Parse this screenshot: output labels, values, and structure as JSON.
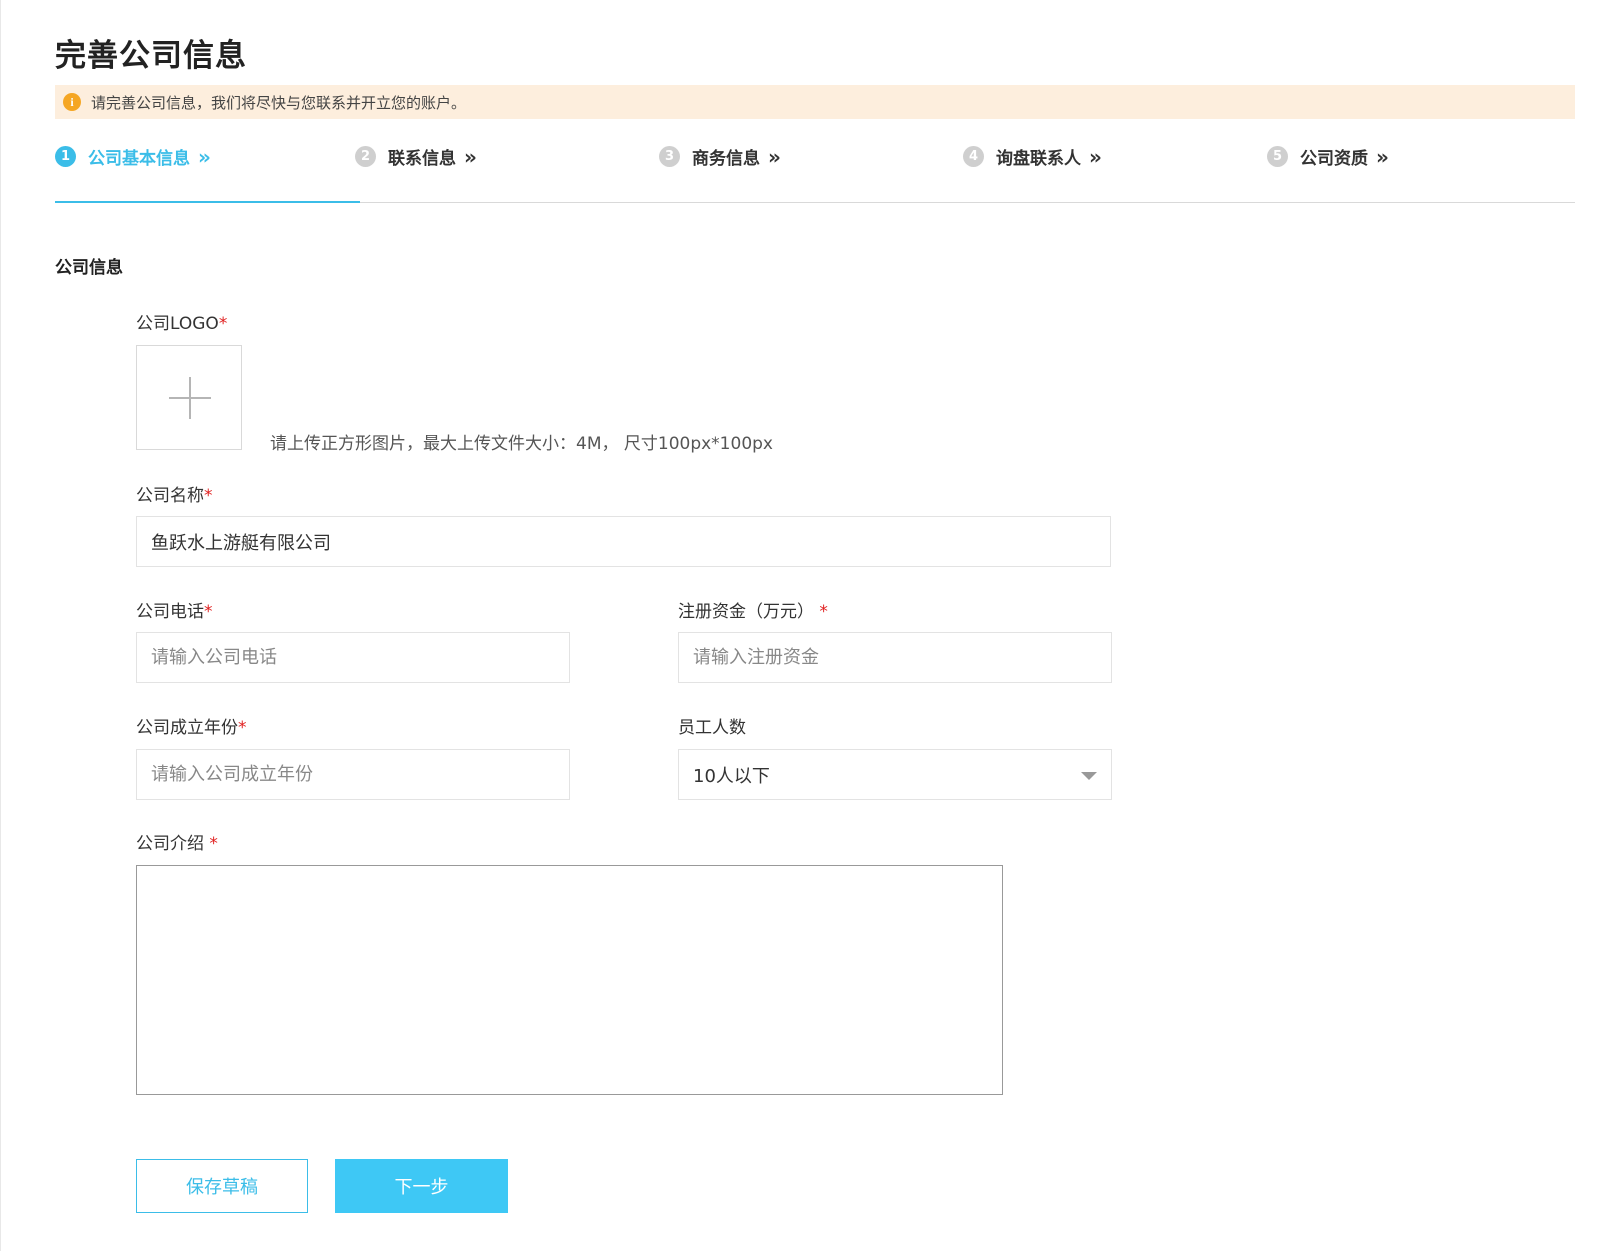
{
  "page": {
    "title": "完善公司信息",
    "notice": "请完善公司信息，我们将尽快与您联系并开立您的账户。",
    "notice_icon": "info-icon"
  },
  "steps": [
    {
      "num": "1",
      "label": "公司基本信息",
      "active": true
    },
    {
      "num": "2",
      "label": "联系信息",
      "active": false
    },
    {
      "num": "3",
      "label": "商务信息",
      "active": false
    },
    {
      "num": "4",
      "label": "询盘联系人",
      "active": false
    },
    {
      "num": "5",
      "label": "公司资质",
      "active": false
    }
  ],
  "step_chevron": "»",
  "section": {
    "title": "公司信息"
  },
  "form": {
    "required_mark": "*",
    "logo": {
      "label": "公司LOGO",
      "hint": "请上传正方形图片，最大上传文件大小：4M， 尺寸100px*100px"
    },
    "company_name": {
      "label": "公司名称",
      "value": "鱼跃水上游艇有限公司"
    },
    "company_phone": {
      "label": "公司电话",
      "placeholder": "请输入公司电话"
    },
    "registered_capital": {
      "label": "注册资金（万元）",
      "placeholder": "请输入注册资金"
    },
    "founded_year": {
      "label": "公司成立年份",
      "placeholder": "请输入公司成立年份"
    },
    "employees": {
      "label": "员工人数",
      "value": "10人以下"
    },
    "intro": {
      "label": "公司介绍",
      "value": ""
    }
  },
  "buttons": {
    "save_draft": "保存草稿",
    "next": "下一步"
  },
  "colors": {
    "accent": "#3bbde8",
    "notice_bg": "#fdeedd",
    "required": "#e02020",
    "warning": "#f5a623"
  }
}
